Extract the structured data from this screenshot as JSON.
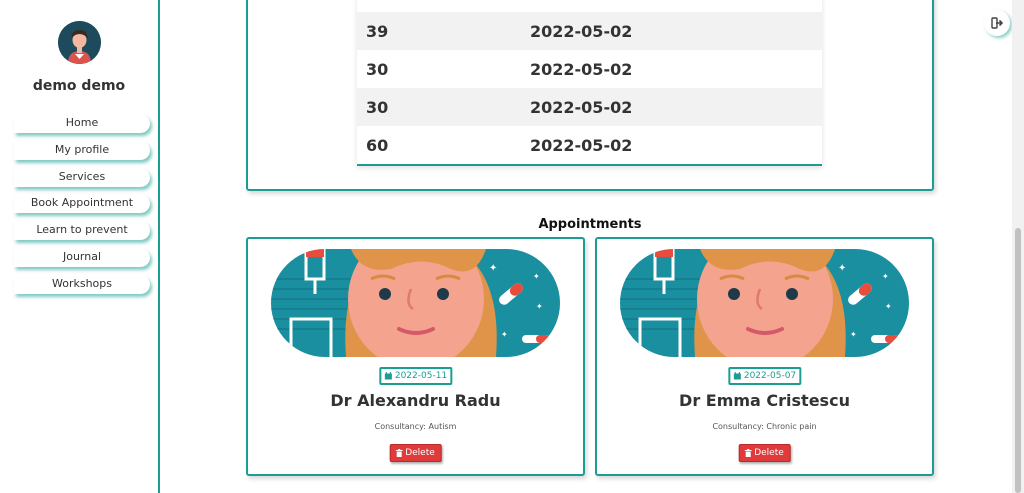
{
  "user": {
    "name": "demo demo"
  },
  "sidebar": {
    "items": [
      {
        "label": "Home"
      },
      {
        "label": "My profile"
      },
      {
        "label": "Services"
      },
      {
        "label": "Book Appointment"
      },
      {
        "label": "Learn to prevent"
      },
      {
        "label": "Journal"
      },
      {
        "label": "Workshops"
      }
    ]
  },
  "table": {
    "rows": [
      {
        "value": "39",
        "date": "2022-05-02"
      },
      {
        "value": "30",
        "date": "2022-05-02"
      },
      {
        "value": "30",
        "date": "2022-05-02"
      },
      {
        "value": "60",
        "date": "2022-05-02"
      }
    ]
  },
  "appointments": {
    "title": "Appointments",
    "cards": [
      {
        "date": "2022-05-11",
        "doctor": "Dr Alexandru Radu",
        "consultancy": "Consultancy: Autism",
        "delete_label": "Delete"
      },
      {
        "date": "2022-05-07",
        "doctor": "Dr Emma Cristescu",
        "consultancy": "Consultancy: Chronic pain",
        "delete_label": "Delete"
      }
    ]
  },
  "icons": {
    "avatar": "user-avatar-icon",
    "logout": "sign-out-icon",
    "calendar": "calendar-icon",
    "trash": "trash-icon"
  },
  "colors": {
    "accent": "#1a9e93",
    "delete": "#e03a3a",
    "doctor_bg": "#1a8fa0",
    "skin": "#f4a38f",
    "hair": "#e0944a"
  }
}
